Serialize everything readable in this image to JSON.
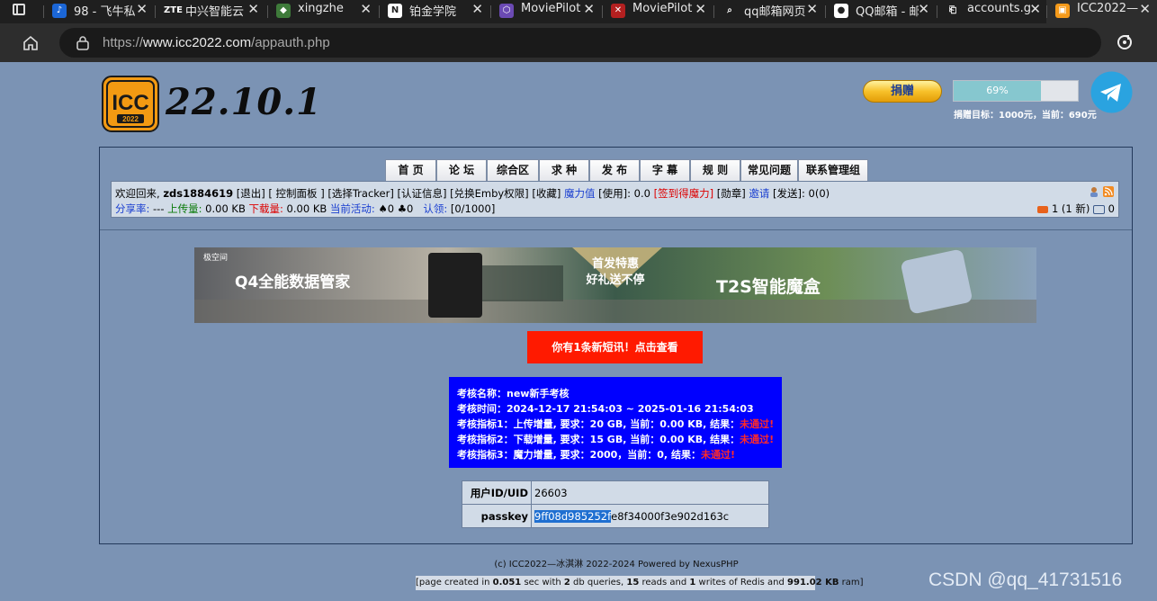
{
  "browser": {
    "tabs": [
      {
        "title": "98 - 飞牛私",
        "icon": "feiniu-icon",
        "color": "#1b66d6",
        "glyph": "♪"
      },
      {
        "title": "中兴智能云",
        "icon": "zte-icon",
        "color": "#1f1f1f",
        "glyph": "ZTE"
      },
      {
        "title": "xingzhe",
        "icon": "xingzhe-icon",
        "color": "#3e7a3a",
        "glyph": "◆"
      },
      {
        "title": "铂金学院",
        "icon": "notion-icon",
        "color": "#ffffff",
        "glyph": "N"
      },
      {
        "title": "MoviePilot",
        "icon": "moviepilot-icon",
        "color": "#6b4ab3",
        "glyph": "⬡"
      },
      {
        "title": "MoviePilot",
        "icon": "moviepilot-red-icon",
        "color": "#b32020",
        "glyph": "✕"
      },
      {
        "title": "qq邮箱网页",
        "icon": "search-icon",
        "color": "#1f1f1f",
        "glyph": "⌕"
      },
      {
        "title": "QQ邮箱 - 邮",
        "icon": "chrome-icon",
        "color": "#ffffff",
        "glyph": "●"
      },
      {
        "title": "accounts.g",
        "icon": "page-icon",
        "color": "#1f1f1f",
        "glyph": "⎗"
      },
      {
        "title": "ICC2022—",
        "icon": "icc-tab-icon",
        "color": "#f59a1a",
        "glyph": "▣"
      }
    ],
    "url_prefix": "https://",
    "url_domain": "www.icc2022.com",
    "url_path": "/appauth.php"
  },
  "header": {
    "logo_text": "ICC",
    "logo_sub": "2022",
    "version": "22.10.1",
    "donate_label": "捐赠",
    "donate_progress": 0.69,
    "donate_progress_text": "69%",
    "donate_goal": "捐赠目标：1000元，当前：690元"
  },
  "nav": [
    {
      "label": "首 页",
      "name": "nav-home"
    },
    {
      "label": "论 坛",
      "name": "nav-forum"
    },
    {
      "label": "综合区",
      "name": "nav-torrents"
    },
    {
      "label": "求 种",
      "name": "nav-requests"
    },
    {
      "label": "发 布",
      "name": "nav-upload"
    },
    {
      "label": "字 幕",
      "name": "nav-subtitles"
    },
    {
      "label": "规 则",
      "name": "nav-rules"
    },
    {
      "label": "常见问题",
      "name": "nav-faq"
    },
    {
      "label": "联系管理组",
      "name": "nav-contact-staff"
    }
  ],
  "userbar": {
    "welcome": "欢迎回来, ",
    "username": "zds1884619",
    "logout": "[退出]",
    "control_panel": "[ 控制面板 ]",
    "select_tracker": "[选择Tracker]",
    "auth_info": "[认证信息]",
    "emby": "[兑换Emby权限]",
    "favorites": "[收藏]",
    "bonus_label": "魔力值",
    "bonus_value": " [使用]: 0.0 ",
    "signin": "[签到得魔力]",
    "medals": " [勋章] ",
    "invite_label": "邀请",
    "invite_value": " [发送]: 0(0)",
    "ratio_label": "分享率:",
    "ratio_value": " --- ",
    "upload_label": "上传量:",
    "upload_value": " 0.00 KB ",
    "download_label": "下载量:",
    "download_value": " 0.00 KB ",
    "active_label": "当前活动:",
    "active_value": " ♠0 ♣0",
    "claim_label": "认领:",
    "claim_value": " [0/1000]",
    "messages": "1 (1 新)",
    "msg_count2": "0"
  },
  "banner": {
    "brand": "极空间",
    "left_text": "Q4全能数据管家",
    "center_line1": "首发特惠",
    "center_line2": "好礼送不停",
    "right_text": "T2S智能魔盒"
  },
  "notice": "你有1条新短讯！点击查看",
  "exam": {
    "name": "考核名称：new新手考核",
    "time": "考核时间：2024-12-17 21:54:03 ~ 2025-01-16 21:54:03",
    "index1": "考核指标1：上传增量, 要求：20 GB, 当前：0.00 KB, 结果：",
    "index2": "考核指标2：下载增量, 要求：15 GB, 当前：0.00 KB, 结果：",
    "index3": "考核指标3：魔力增量, 要求：2000，当前：0, 结果：",
    "fail": "未通过!"
  },
  "uid_table": {
    "uid_label": "用户ID/UID",
    "uid_value": "26603",
    "passkey_label": "passkey",
    "passkey_selected": "9ff08d985252f",
    "passkey_rest": "e8f34000f3e902d163c"
  },
  "footer": {
    "copyright": "(c) ICC2022—冰淇淋 2022-2024 Powered by NexusPHP",
    "page_info_1": "[page created in ",
    "page_time": "0.051",
    "page_info_2": " sec with ",
    "db_queries": "2",
    "page_info_3": " db queries, ",
    "reads": "15",
    "page_info_4": " reads and ",
    "writes": "1",
    "page_info_5": " writes of Redis and ",
    "ram": "991.02 KB",
    "page_info_6": " ram]"
  },
  "watermark": "CSDN @qq_41731516"
}
